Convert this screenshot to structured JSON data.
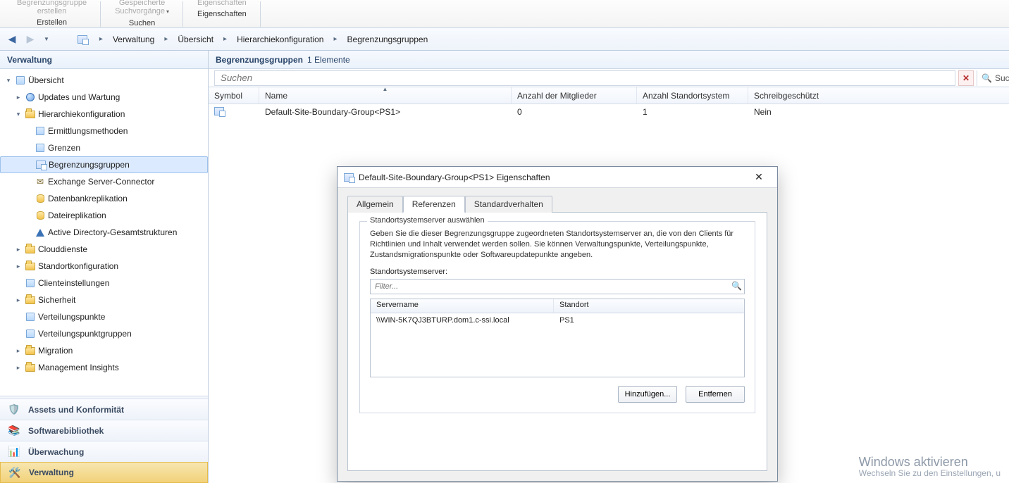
{
  "ribbon": {
    "group1_top": "Begrenzungsgruppe\nerstellen",
    "group1_bottom": "Erstellen",
    "group2_top": "Gespeicherte\nSuchvorgänge",
    "group2_bottom": "Suchen",
    "group3_top": "Eigenschaften",
    "group3_bottom": "Eigenschaften"
  },
  "breadcrumb": {
    "items": [
      "Verwaltung",
      "Übersicht",
      "Hierarchiekonfiguration",
      "Begrenzungsgruppen"
    ]
  },
  "left": {
    "title": "Verwaltung",
    "tree": {
      "uebersicht": "Übersicht",
      "updates": "Updates und Wartung",
      "hier": "Hierarchiekonfiguration",
      "ermitt": "Ermittlungsmethoden",
      "grenzen": "Grenzen",
      "begrenz": "Begrenzungsgruppen",
      "exchange": "Exchange Server-Connector",
      "dbrep": "Datenbankreplikation",
      "filerep": "Dateireplikation",
      "adgs": "Active Directory-Gesamtstrukturen",
      "cloud": "Clouddienste",
      "standort": "Standortkonfiguration",
      "clientein": "Clienteinstellungen",
      "sicher": "Sicherheit",
      "vpunkte": "Verteilungspunkte",
      "vpgruppen": "Verteilungspunktgruppen",
      "migration": "Migration",
      "mgmtins": "Management Insights"
    },
    "workspaces": {
      "assets": "Assets und Konformität",
      "software": "Softwarebibliothek",
      "monitor": "Überwachung",
      "admin": "Verwaltung"
    }
  },
  "list": {
    "heading": "Begrenzungsgruppen",
    "count_suffix": "1 Elemente",
    "search_placeholder": "Suchen",
    "search_go": "Suc",
    "cols": {
      "symbol": "Symbol",
      "name": "Name",
      "members": "Anzahl der Mitglieder",
      "sites": "Anzahl Standortsystem",
      "readonly": "Schreibgeschützt"
    },
    "rows": [
      {
        "name": "Default-Site-Boundary-Group<PS1>",
        "members": "0",
        "sites": "1",
        "readonly": "Nein"
      }
    ]
  },
  "dialog": {
    "title": "Default-Site-Boundary-Group<PS1> Eigenschaften",
    "tabs": {
      "general": "Allgemein",
      "references": "Referenzen",
      "default": "Standardverhalten"
    },
    "group_legend": "Standortsystemserver auswählen",
    "group_text": "Geben Sie die dieser Begrenzungsgruppe zugeordneten Standortsystemserver an, die von den Clients für Richtlinien und Inhalt verwendet werden sollen. Sie können Verwaltungspunkte, Verteilungspunkte, Zustandsmigrationspunkte oder Softwareupdatepunkte angeben.",
    "servers_label": "Standortsystemserver:",
    "filter_placeholder": "Filter...",
    "srv_cols": {
      "server": "Servername",
      "site": "Standort"
    },
    "srv_rows": [
      {
        "server": "\\\\WIN-5K7QJ3BTURP.dom1.c-ssi.local",
        "site": "PS1"
      }
    ],
    "btn_add": "Hinzufügen...",
    "btn_remove": "Entfernen"
  },
  "watermark": {
    "line1": "Windows aktivieren",
    "line2": "Wechseln Sie zu den Einstellungen, u"
  }
}
